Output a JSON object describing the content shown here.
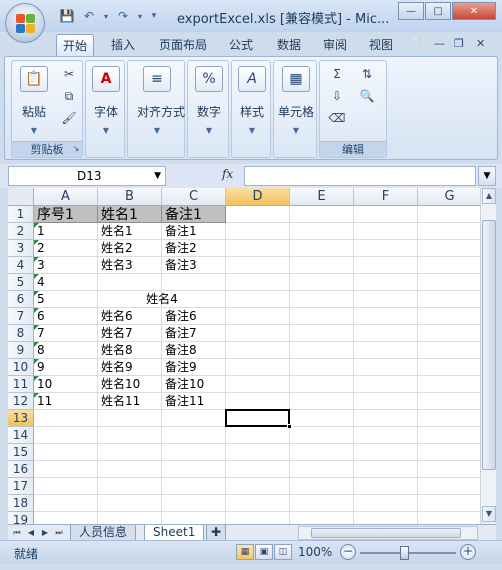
{
  "window": {
    "title": "exportExcel.xls  [兼容模式] - Mic..."
  },
  "tabs": [
    {
      "label": "开始",
      "active": true
    },
    {
      "label": "插入"
    },
    {
      "label": "页面布局"
    },
    {
      "label": "公式"
    },
    {
      "label": "数据"
    },
    {
      "label": "审阅"
    },
    {
      "label": "视图"
    }
  ],
  "ribbon": {
    "clipboard": {
      "paste": "粘贴",
      "group": "剪贴板"
    },
    "font": {
      "label": "字体"
    },
    "align": {
      "label": "对齐方式"
    },
    "number": {
      "label": "数字"
    },
    "style": {
      "label": "样式"
    },
    "cells": {
      "label": "单元格"
    },
    "editing": {
      "group": "编辑"
    }
  },
  "formula_bar": {
    "name_box": "D13",
    "fx": "fx",
    "formula": ""
  },
  "sheet": {
    "columns": [
      "A",
      "B",
      "C",
      "D",
      "E",
      "F",
      "G"
    ],
    "rows": [
      "1",
      "2",
      "3",
      "4",
      "5",
      "6",
      "7",
      "8",
      "9",
      "10",
      "11",
      "12",
      "13",
      "14",
      "15",
      "16",
      "17",
      "18",
      "19"
    ],
    "headers": [
      "序号1",
      "姓名1",
      "备注1"
    ],
    "data": [
      [
        "1",
        "姓名1",
        "备注1"
      ],
      [
        "2",
        "姓名2",
        "备注2"
      ],
      [
        "3",
        "姓名3",
        "备注3"
      ],
      [
        "4",
        "",
        ""
      ],
      [
        "5",
        "姓名4",
        ""
      ],
      [
        "6",
        "姓名6",
        "备注6"
      ],
      [
        "7",
        "姓名7",
        "备注7"
      ],
      [
        "8",
        "姓名8",
        "备注8"
      ],
      [
        "9",
        "姓名9",
        "备注9"
      ],
      [
        "10",
        "姓名10",
        "备注10"
      ],
      [
        "11",
        "姓名11",
        "备注11"
      ]
    ],
    "selected_cell": "D13"
  },
  "sheet_tabs": [
    {
      "label": "人员信息"
    },
    {
      "label": "Sheet1",
      "active": true
    }
  ],
  "status": {
    "ready": "就绪",
    "zoom": "100%"
  },
  "colors": {
    "header_fill": "#c0c0c0",
    "selected_header": "#f1c15d",
    "number_text_flag": "#2e8b3c"
  }
}
